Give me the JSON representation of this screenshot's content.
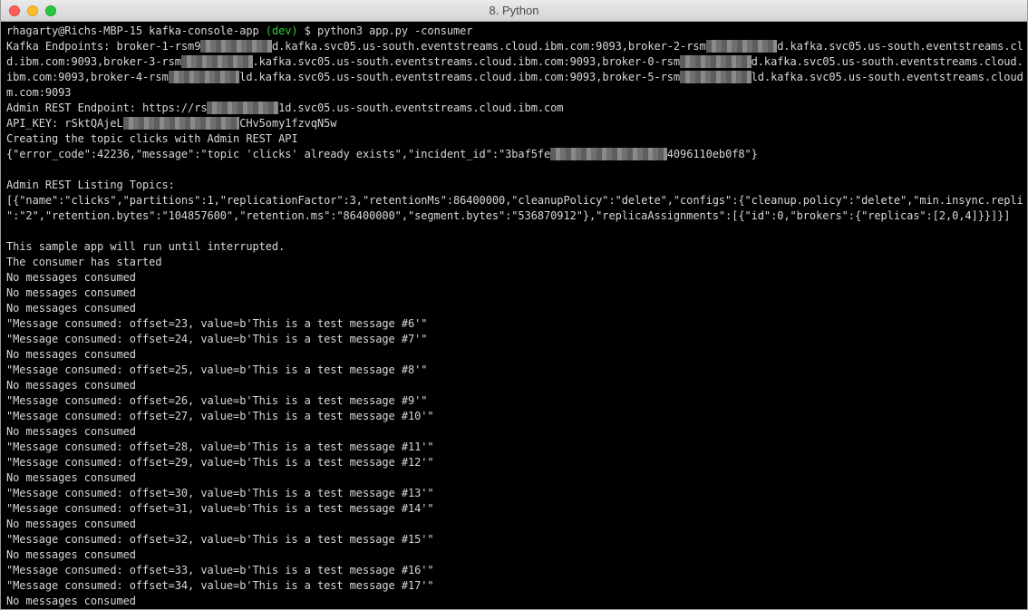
{
  "window": {
    "title": "8. Python"
  },
  "colors": {
    "background": "#000000",
    "text": "#d8d8d8",
    "branch": "#2fce2f",
    "redaction": "#777777"
  },
  "terminal": {
    "lines": [
      [
        {
          "t": "rhagarty@Richs-MBP-15 kafka-console-app "
        },
        {
          "t": "(dev)",
          "c": "branch"
        },
        {
          "t": " $ python3 app.py -consumer"
        }
      ],
      [
        {
          "t": "Kafka Endpoints: broker-1-rsm9"
        },
        {
          "t": "           ",
          "c": "redact"
        },
        {
          "t": "d.kafka.svc05.us-south.eventstreams.cloud.ibm.com:9093,broker-2-rsm"
        },
        {
          "t": "           ",
          "c": "redact"
        },
        {
          "t": "d.kafka.svc05.us-south.eventstreams.clou"
        }
      ],
      [
        {
          "t": "d.ibm.com:9093,broker-3-rsm"
        },
        {
          "t": "           ",
          "c": "redact"
        },
        {
          "t": ".kafka.svc05.us-south.eventstreams.cloud.ibm.com:9093,broker-0-rsm"
        },
        {
          "t": "           ",
          "c": "redact"
        },
        {
          "t": "d.kafka.svc05.us-south.eventstreams.cloud."
        }
      ],
      [
        {
          "t": "ibm.com:9093,broker-4-rsm"
        },
        {
          "t": "           ",
          "c": "redact"
        },
        {
          "t": "ld.kafka.svc05.us-south.eventstreams.cloud.ibm.com:9093,broker-5-rsm"
        },
        {
          "t": "           ",
          "c": "redact"
        },
        {
          "t": "ld.kafka.svc05.us-south.eventstreams.cloud.ib"
        }
      ],
      [
        {
          "t": "m.com:9093"
        }
      ],
      [
        {
          "t": "Admin REST Endpoint: https://rs"
        },
        {
          "t": "           ",
          "c": "redact"
        },
        {
          "t": "1d.svc05.us-south.eventstreams.cloud.ibm.com"
        }
      ],
      [
        {
          "t": "API_KEY: rSktQAjeL"
        },
        {
          "t": "                  ",
          "c": "redact"
        },
        {
          "t": "CHv5omy1fzvqN5w"
        }
      ],
      [
        {
          "t": "Creating the topic clicks with Admin REST API"
        }
      ],
      [
        {
          "t": "{\"error_code\":42236,\"message\":\"topic 'clicks' already exists\",\"incident_id\":\"3baf5fe"
        },
        {
          "t": "                  ",
          "c": "redact"
        },
        {
          "t": "4096110eb0f8\"}"
        }
      ],
      [
        {
          "t": ""
        }
      ],
      [
        {
          "t": "Admin REST Listing Topics:"
        }
      ],
      [
        {
          "t": "[{\"name\":\"clicks\",\"partitions\":1,\"replicationFactor\":3,\"retentionMs\":86400000,\"cleanupPolicy\":\"delete\",\"configs\":{\"cleanup.policy\":\"delete\",\"min.insync.replicas"
        }
      ],
      [
        {
          "t": "\":\"2\",\"retention.bytes\":\"104857600\",\"retention.ms\":\"86400000\",\"segment.bytes\":\"536870912\"},\"replicaAssignments\":[{\"id\":0,\"brokers\":{\"replicas\":[2,0,4]}}]}]"
        }
      ],
      [
        {
          "t": ""
        }
      ],
      [
        {
          "t": "This sample app will run until interrupted."
        }
      ],
      [
        {
          "t": "The consumer has started"
        }
      ],
      [
        {
          "t": "No messages consumed"
        }
      ],
      [
        {
          "t": "No messages consumed"
        }
      ],
      [
        {
          "t": "No messages consumed"
        }
      ],
      [
        {
          "t": "\"Message consumed: offset=23, value=b'This is a test message #6'\""
        }
      ],
      [
        {
          "t": "\"Message consumed: offset=24, value=b'This is a test message #7'\""
        }
      ],
      [
        {
          "t": "No messages consumed"
        }
      ],
      [
        {
          "t": "\"Message consumed: offset=25, value=b'This is a test message #8'\""
        }
      ],
      [
        {
          "t": "No messages consumed"
        }
      ],
      [
        {
          "t": "\"Message consumed: offset=26, value=b'This is a test message #9'\""
        }
      ],
      [
        {
          "t": "\"Message consumed: offset=27, value=b'This is a test message #10'\""
        }
      ],
      [
        {
          "t": "No messages consumed"
        }
      ],
      [
        {
          "t": "\"Message consumed: offset=28, value=b'This is a test message #11'\""
        }
      ],
      [
        {
          "t": "\"Message consumed: offset=29, value=b'This is a test message #12'\""
        }
      ],
      [
        {
          "t": "No messages consumed"
        }
      ],
      [
        {
          "t": "\"Message consumed: offset=30, value=b'This is a test message #13'\""
        }
      ],
      [
        {
          "t": "\"Message consumed: offset=31, value=b'This is a test message #14'\""
        }
      ],
      [
        {
          "t": "No messages consumed"
        }
      ],
      [
        {
          "t": "\"Message consumed: offset=32, value=b'This is a test message #15'\""
        }
      ],
      [
        {
          "t": "No messages consumed"
        }
      ],
      [
        {
          "t": "\"Message consumed: offset=33, value=b'This is a test message #16'\""
        }
      ],
      [
        {
          "t": "\"Message consumed: offset=34, value=b'This is a test message #17'\""
        }
      ],
      [
        {
          "t": "No messages consumed"
        }
      ]
    ]
  }
}
